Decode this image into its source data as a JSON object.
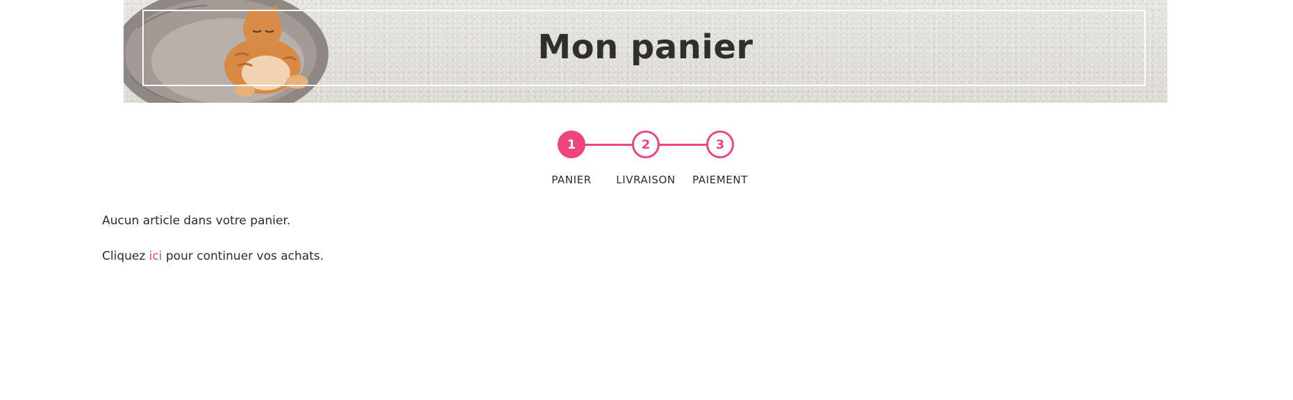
{
  "header": {
    "title": "Mon panier",
    "banner_image": "sleeping-ginger-cat-in-pet-bed"
  },
  "stepper": {
    "accent_color": "#f0447d",
    "current_step": 1,
    "steps": [
      {
        "number": "1",
        "label": "PANIER"
      },
      {
        "number": "2",
        "label": "LIVRAISON"
      },
      {
        "number": "3",
        "label": "PAIEMENT"
      }
    ]
  },
  "cart": {
    "empty_message": "Aucun article dans votre panier.",
    "continue_prefix": "Cliquez ",
    "continue_link": "ici",
    "continue_suffix": " pour continuer vos achats."
  }
}
